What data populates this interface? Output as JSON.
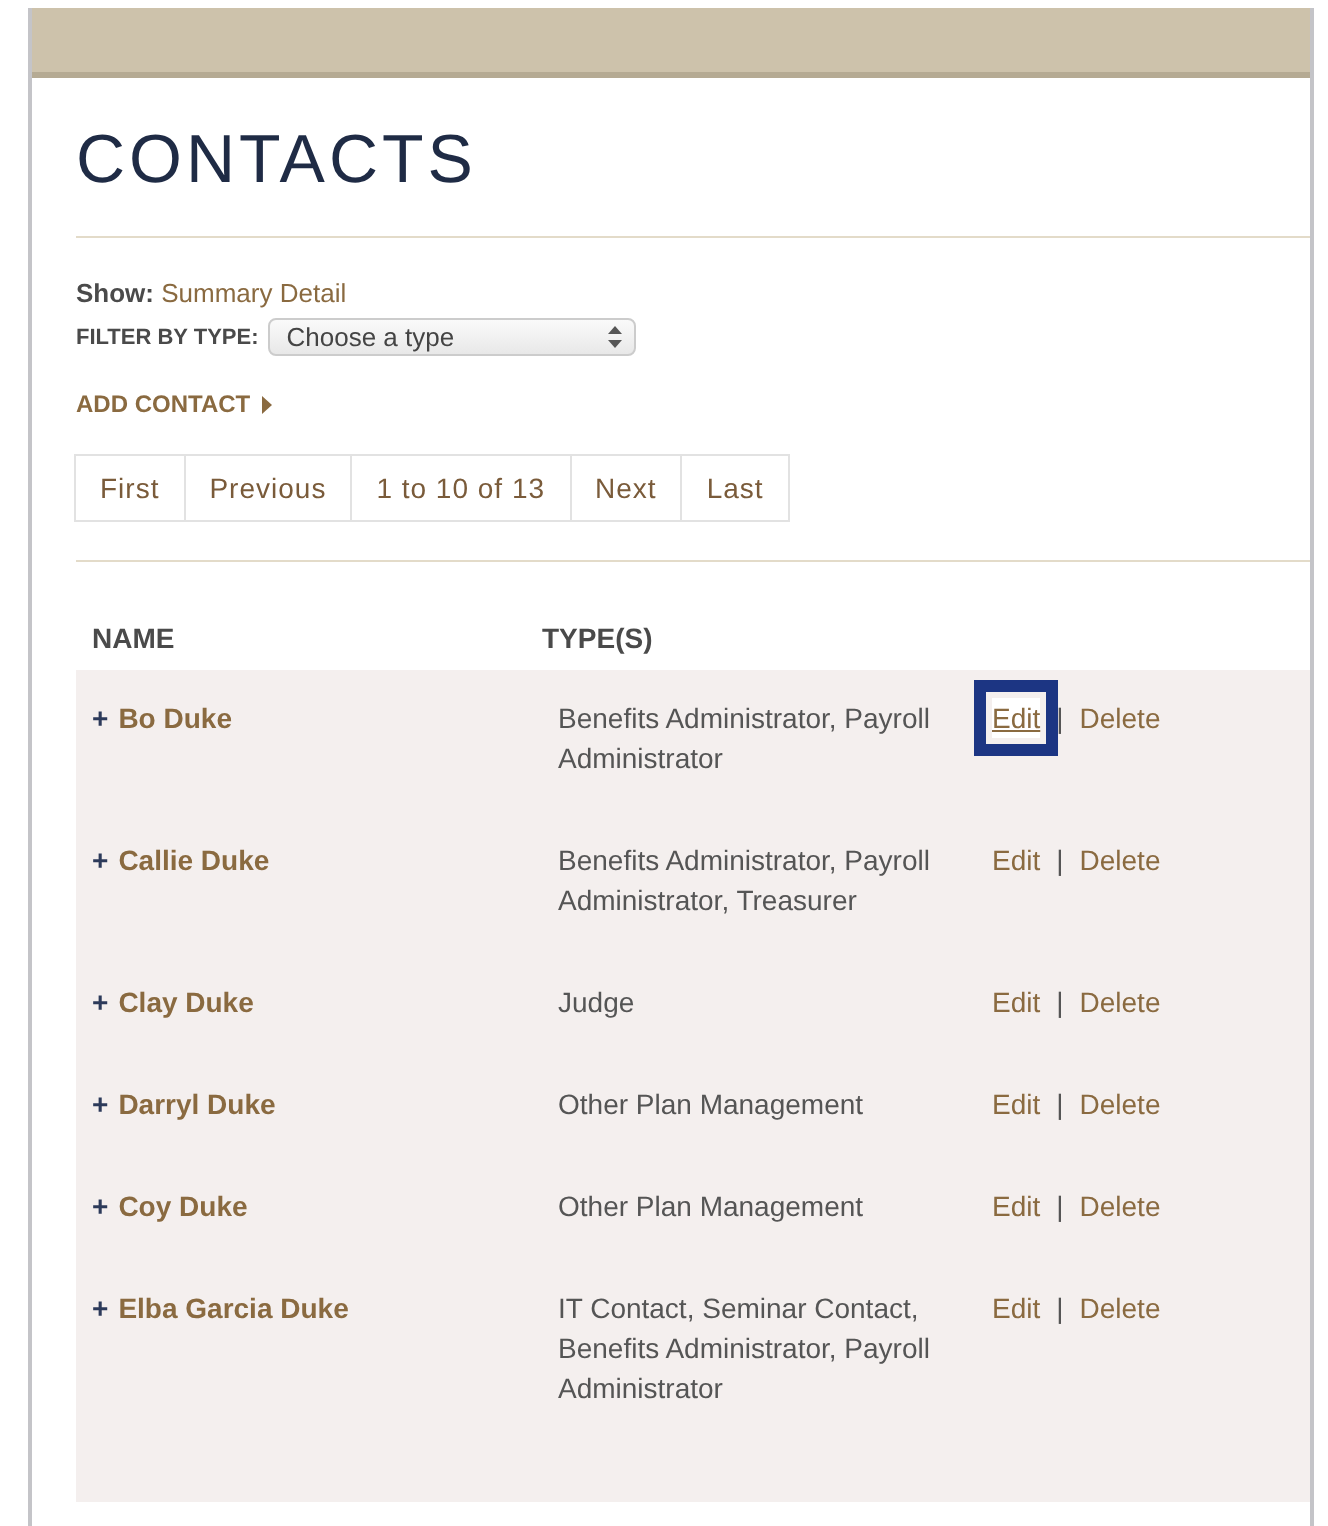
{
  "title": "CONTACTS",
  "show": {
    "label": "Show:",
    "value": "Summary Detail"
  },
  "filter": {
    "label": "FILTER BY TYPE:",
    "value": "Choose a type"
  },
  "add_contact": {
    "label": "ADD CONTACT"
  },
  "pager": [
    "First",
    "Previous",
    "1 to 10 of 13",
    "Next",
    "Last"
  ],
  "table": {
    "columns": [
      "NAME",
      "TYPE(S)"
    ],
    "rows": [
      {
        "expander": "+",
        "name": "Bo Duke",
        "types": "Benefits Administrator, Payroll Administrator",
        "edit": "Edit",
        "separator": "|",
        "delete": "Delete",
        "highlighted": true
      },
      {
        "expander": "+",
        "name": "Callie Duke",
        "types": "Benefits Administrator, Payroll Administrator, Treasurer",
        "edit": "Edit",
        "separator": "|",
        "delete": "Delete",
        "highlighted": false
      },
      {
        "expander": "+",
        "name": "Clay Duke",
        "types": "Judge",
        "edit": "Edit",
        "separator": "|",
        "delete": "Delete",
        "highlighted": false
      },
      {
        "expander": "+",
        "name": "Darryl Duke",
        "types": "Other Plan Management",
        "edit": "Edit",
        "separator": "|",
        "delete": "Delete",
        "highlighted": false
      },
      {
        "expander": "+",
        "name": "Coy Duke",
        "types": "Other Plan Management",
        "edit": "Edit",
        "separator": "|",
        "delete": "Delete",
        "highlighted": false
      },
      {
        "expander": "+",
        "name": "Elba Garcia Duke",
        "types": "IT Contact, Seminar Contact, Benefits Administrator, Payroll Administrator",
        "edit": "Edit",
        "separator": "|",
        "delete": "Delete",
        "highlighted": false
      }
    ]
  }
}
